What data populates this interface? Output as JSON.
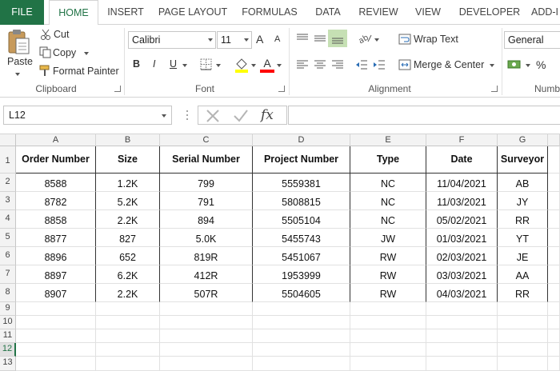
{
  "ribbon_tabs": [
    "FILE",
    "HOME",
    "INSERT",
    "PAGE LAYOUT",
    "FORMULAS",
    "DATA",
    "REVIEW",
    "VIEW",
    "DEVELOPER",
    "ADD-I"
  ],
  "clipboard": {
    "paste": "Paste",
    "cut": "Cut",
    "copy": "Copy",
    "format_painter": "Format Painter",
    "label": "Clipboard"
  },
  "font": {
    "name": "Calibri",
    "size": "11",
    "grow": "A",
    "shrink": "A",
    "bold": "B",
    "italic": "I",
    "underline": "U",
    "font_color_letter": "A",
    "label": "Font",
    "highlight_color": "#ffff00",
    "text_color": "#ff0000"
  },
  "alignment": {
    "wrap_text": "Wrap Text",
    "merge_center": "Merge & Center",
    "label": "Alignment"
  },
  "number": {
    "format": "General",
    "percent": "%",
    "label": "Numb"
  },
  "formula_bar": {
    "name_box": "L12",
    "fx": "fx",
    "value": ""
  },
  "sheet": {
    "columns": [
      "A",
      "B",
      "C",
      "D",
      "E",
      "F",
      "G"
    ],
    "rows": [
      "1",
      "2",
      "3",
      "4",
      "5",
      "6",
      "7",
      "8",
      "9",
      "10",
      "11",
      "12",
      "13"
    ],
    "selected_row": "12",
    "headers": [
      "Order Number",
      "Size",
      "Serial Number",
      "Project Number",
      "Type",
      "Date",
      "Surveyor"
    ],
    "data": [
      [
        "8588",
        "1.2K",
        "799",
        "5559381",
        "NC",
        "11/04/2021",
        "AB"
      ],
      [
        "8782",
        "5.2K",
        "791",
        "5808815",
        "NC",
        "11/03/2021",
        "JY"
      ],
      [
        "8858",
        "2.2K",
        "894",
        "5505104",
        "NC",
        "05/02/2021",
        "RR"
      ],
      [
        "8877",
        "827",
        "5.0K",
        "5455743",
        "JW",
        "01/03/2021",
        "YT"
      ],
      [
        "8896",
        "652",
        "819R",
        "5451067",
        "RW",
        "02/03/2021",
        "JE"
      ],
      [
        "8897",
        "6.2K",
        "412R",
        "1953999",
        "RW",
        "03/03/2021",
        "AA"
      ],
      [
        "8907",
        "2.2K",
        "507R",
        "5504605",
        "RW",
        "04/03/2021",
        "RR"
      ]
    ]
  },
  "colors": {
    "accent": "#217346"
  }
}
